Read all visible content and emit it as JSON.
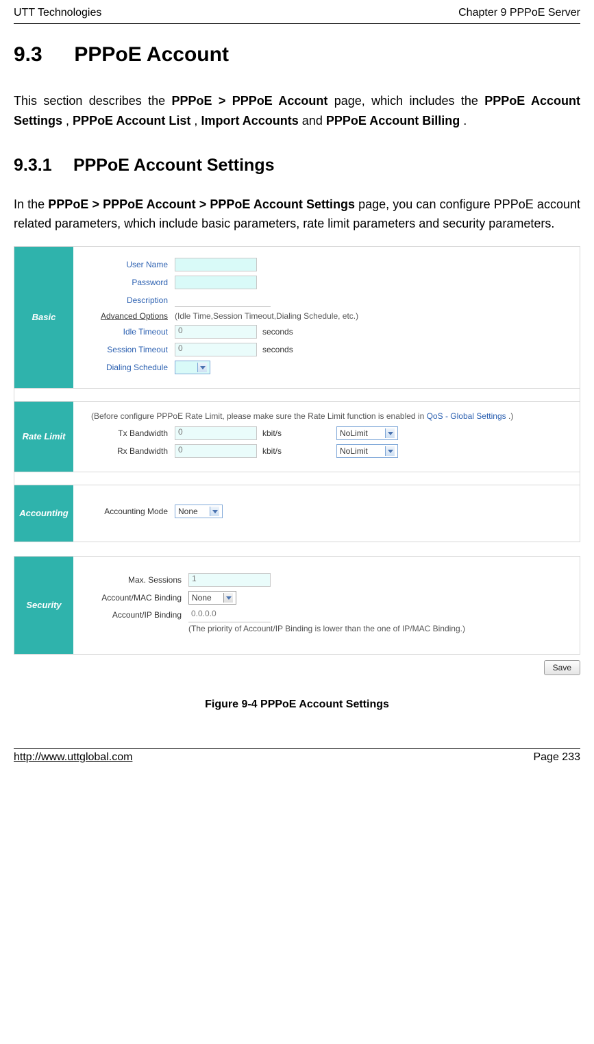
{
  "header": {
    "left": "UTT Technologies",
    "right": "Chapter 9 PPPoE Server"
  },
  "section_93": {
    "num": "9.3",
    "title": "PPPoE Account",
    "para_segments": [
      "This section describes the ",
      "PPPoE > PPPoE Account",
      " page, which includes the ",
      "PPPoE Account Settings",
      ", ",
      "PPPoE Account List",
      ", ",
      "Import Accounts",
      " and ",
      "PPPoE Account Billing",
      "."
    ]
  },
  "section_931": {
    "num": "9.3.1",
    "title": "PPPoE Account Settings",
    "para_segments": [
      "In the ",
      "PPPoE > PPPoE Account > PPPoE Account Settings",
      " page, you can configure PPPoE account related parameters, which include basic parameters, rate limit parameters and security parameters."
    ]
  },
  "screenshot": {
    "basic": {
      "tab_label": "Basic",
      "user_name_label": "User Name",
      "user_name_value": "",
      "password_label": "Password",
      "password_value": "",
      "description_label": "Description",
      "description_value": "",
      "advanced_options_label": "Advanced Options",
      "advanced_options_hint": "(Idle Time,Session Timeout,Dialing Schedule, etc.)",
      "idle_timeout_label": "Idle Timeout",
      "idle_timeout_value": "0",
      "idle_timeout_unit": "seconds",
      "session_timeout_label": "Session Timeout",
      "session_timeout_value": "0",
      "session_timeout_unit": "seconds",
      "dialing_schedule_label": "Dialing Schedule",
      "dialing_schedule_value": ""
    },
    "rate": {
      "tab_label": "Rate Limit",
      "note_pre": "(Before configure PPPoE Rate Limit, please make sure the Rate Limit function is enabled in ",
      "note_link": "QoS - Global Settings",
      "note_post": ".)",
      "tx_label": "Tx Bandwidth",
      "tx_value": "0",
      "tx_unit": "kbit/s",
      "tx_limit": "NoLimit",
      "rx_label": "Rx Bandwidth",
      "rx_value": "0",
      "rx_unit": "kbit/s",
      "rx_limit": "NoLimit"
    },
    "accounting": {
      "tab_label": "Accounting",
      "mode_label": "Accounting Mode",
      "mode_value": "None"
    },
    "security": {
      "tab_label": "Security",
      "max_sessions_label": "Max. Sessions",
      "max_sessions_value": "1",
      "mac_binding_label": "Account/MAC Binding",
      "mac_binding_value": "None",
      "ip_binding_label": "Account/IP Binding",
      "ip_binding_value": "0.0.0.0",
      "ip_binding_note": "(The priority of Account/IP Binding is lower than the one of IP/MAC Binding.)"
    },
    "save_label": "Save"
  },
  "figure_caption": "Figure 9-4 PPPoE Account Settings",
  "footer": {
    "url": "http://www.uttglobal.com",
    "page_label": "Page  233"
  }
}
